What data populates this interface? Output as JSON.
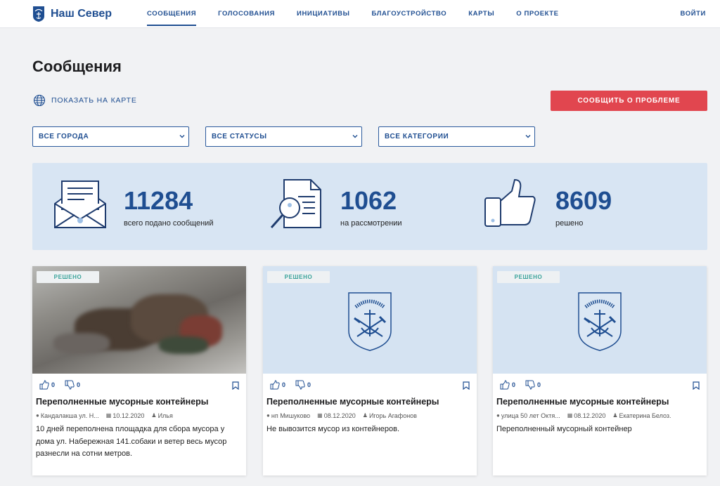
{
  "header": {
    "logo_text": "Наш Север",
    "nav": [
      {
        "label": "СООБЩЕНИЯ",
        "active": true
      },
      {
        "label": "ГОЛОСОВАНИЯ",
        "active": false
      },
      {
        "label": "ИНИЦИАТИВЫ",
        "active": false
      },
      {
        "label": "БЛАГОУСТРОЙСТВО",
        "active": false
      },
      {
        "label": "КАРТЫ",
        "active": false
      },
      {
        "label": "О ПРОЕКТЕ",
        "active": false
      }
    ],
    "login_label": "ВОЙТИ"
  },
  "page": {
    "title": "Сообщения",
    "map_link": "ПОКАЗАТЬ НА КАРТЕ",
    "report_button": "СООБЩИТЬ О ПРОБЛЕМЕ"
  },
  "filters": {
    "city": "ВСЕ ГОРОДА",
    "status": "ВСЕ СТАТУСЫ",
    "category": "ВСЕ КАТЕГОРИИ"
  },
  "stats": [
    {
      "value": "11284",
      "label": "всего подано сообщений",
      "icon": "envelope-icon"
    },
    {
      "value": "1062",
      "label": "на рассмотрении",
      "icon": "document-search-icon"
    },
    {
      "value": "8609",
      "label": "решено",
      "icon": "thumbs-up-icon"
    }
  ],
  "cards": [
    {
      "status": "РЕШЕНО",
      "likes": "0",
      "dislikes": "0",
      "title": "Переполненные мусорные контейнеры",
      "location": "Кандалакша ул. Н...",
      "date": "10.12.2020",
      "author": "Илья",
      "description": "10 дней переполнена площадка для сбора мусора у дома ул. Набережная 141.собаки и ветер весь мусор разнесли на сотни метров."
    },
    {
      "status": "РЕШЕНО",
      "likes": "0",
      "dislikes": "0",
      "title": "Переполненные мусорные контейнеры",
      "location": "нп Мишуково",
      "date": "08.12.2020",
      "author": "Игорь Агафонов",
      "description": "Не вывозится мусор из контейнеров."
    },
    {
      "status": "РЕШЕНО",
      "likes": "0",
      "dislikes": "0",
      "title": "Переполненные мусорные контейнеры",
      "location": "улица 50 лет Октя...",
      "date": "08.12.2020",
      "author": "Екатерина Белоз.",
      "description": "Переполненный мусорный контейнер"
    }
  ],
  "colors": {
    "brand": "#1f4e91",
    "accent": "#e1464f",
    "stats_bg": "#d8e5f3",
    "resolved": "#3aa39a"
  }
}
